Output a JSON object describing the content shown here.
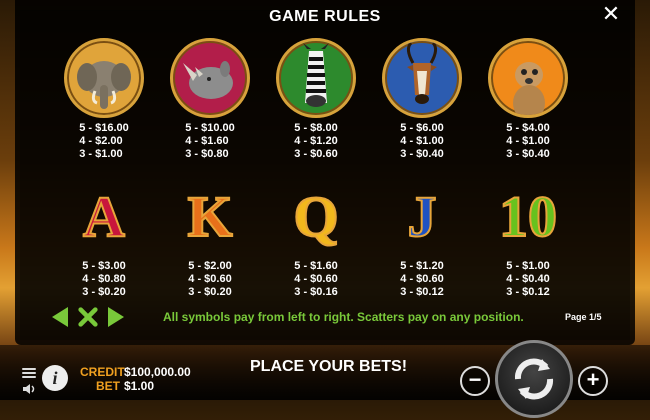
{
  "title": "GAME RULES",
  "close_label": "✕",
  "animals": [
    {
      "name": "elephant",
      "bg": "#e0a43a",
      "pays": "5 - $16.00\n4 - $2.00\n3 - $1.00"
    },
    {
      "name": "rhino",
      "bg": "#b21e4a",
      "pays": "5 - $10.00\n4 - $1.60\n3 - $0.80"
    },
    {
      "name": "zebra",
      "bg": "#2d8a2d",
      "pays": "5 - $8.00\n4 - $1.20\n3 - $0.60"
    },
    {
      "name": "antelope",
      "bg": "#2c5cb0",
      "pays": "5 - $6.00\n4 - $1.00\n3 - $0.40"
    },
    {
      "name": "meerkat",
      "bg": "#f08a1a",
      "pays": "5 - $4.00\n4 - $1.00\n3 - $0.40"
    }
  ],
  "cards": [
    {
      "letter": "A",
      "color": "#c8163c",
      "pays": "5 - $3.00\n4 - $0.80\n3 - $0.20"
    },
    {
      "letter": "K",
      "color": "#e8701a",
      "pays": "5 - $2.00\n4 - $0.60\n3 - $0.20"
    },
    {
      "letter": "Q",
      "color": "#f2b81c",
      "pays": "5 - $1.60\n4 - $0.60\n3 - $0.16"
    },
    {
      "letter": "J",
      "color": "#1f52c2",
      "pays": "5 - $1.20\n4 - $0.60\n3 - $0.12"
    },
    {
      "letter": "10",
      "color": "#67c21e",
      "pays": "5 - $1.00\n4 - $0.40\n3 - $0.12"
    }
  ],
  "info_text": "All symbols pay from left to right. Scatters pay on any position.",
  "page_label": "Page 1/5",
  "credit_label": "CREDIT",
  "credit_value": "$100,000.00",
  "bet_label": "BET",
  "bet_value": "$1.00",
  "place_bets": "PLACE YOUR BETS!",
  "colors": {
    "accent_green": "#79c93a",
    "gold": "#d7a23b",
    "credit_orange": "#f0a020"
  },
  "icons": [
    "close-icon",
    "arrow-left-icon",
    "x-icon",
    "arrow-right-icon",
    "menu-icon",
    "info-icon",
    "sound-icon",
    "spin-icon",
    "minus-icon",
    "plus-icon"
  ]
}
